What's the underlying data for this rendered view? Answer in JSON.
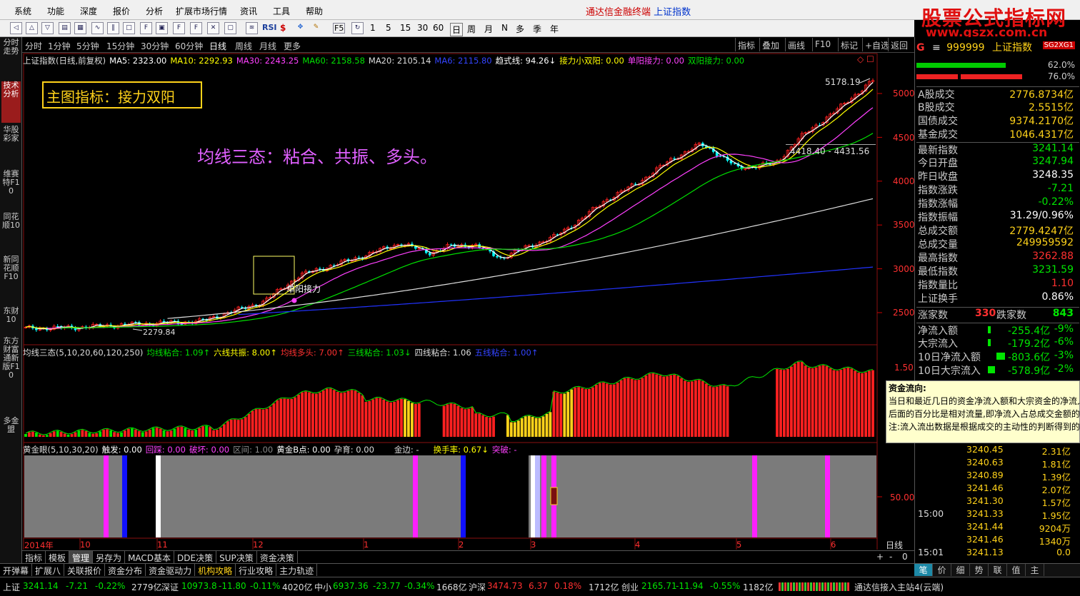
{
  "menu": {
    "items": [
      "系统",
      "功能",
      "深度",
      "报价",
      "分析",
      "扩展市场行情",
      "资讯",
      "工具",
      "帮助"
    ],
    "title_app": "通达信金融终端",
    "title_index": "上证指数"
  },
  "toolbar": {
    "buttons": [
      "RSI",
      "$",
      "F5",
      "1",
      "5",
      "15",
      "30",
      "60",
      "日",
      "周",
      "月",
      "N",
      "多",
      "季",
      "年"
    ]
  },
  "watermark": {
    "line1": "股票公式指标网",
    "line2": "www.gszx.com.cn"
  },
  "lefttabs": [
    "分时走势",
    "技术分析",
    "华股彩家",
    "维赛特F10",
    "同花顺10",
    "新同花顺F10",
    "东财10",
    "东方财富通新版F10",
    "多金盟"
  ],
  "periods": [
    "分时",
    "1分钟",
    "5分钟",
    "15分钟",
    "30分钟",
    "60分钟",
    "日线",
    "周线",
    "月线",
    "更多"
  ],
  "rightbtns": [
    "指标",
    "叠加",
    "画线",
    "F10",
    "标记",
    "+自选",
    "返回"
  ],
  "main_ind": {
    "name": "上证指数(日线,前复权)",
    "ma5": "MA5: 2323.00",
    "ma10": "MA10: 2292.93",
    "ma30": "MA30: 2243.25",
    "ma60": "MA60: 2158.58",
    "ma20": "MA20: 2105.14",
    "ma6": "MA6: 2115.80",
    "trend": "趋式线: 94.26↓",
    "relay": "接力小双阳: 0.00",
    "single": "单阳接力: 0.00",
    "double": "双阳接力: 0.00"
  },
  "annot": {
    "box": "主图指标：接力双阳",
    "text": "均线三态：粘合、共振、多头。",
    "hi": "5178.19",
    "range": "4418.40 - 4431.56",
    "lo": "2279.84",
    "relay_label": "单阳接力"
  },
  "price_axis": [
    "5000",
    "4500",
    "4000",
    "3500",
    "3000",
    "2500"
  ],
  "ind2": {
    "name": "均线三态(5,10,20,60,120,250)",
    "a": "均线粘合: 1.09↑",
    "b": "六线共振: 8.00↑",
    "c": "均线多头: 7.00↑",
    "d": "三线粘合: 1.03↓",
    "e": "四线粘合: 1.06",
    "f": "五线粘合: 1.00↑",
    "axis": "1.50"
  },
  "ind3": {
    "name": "黄金眼(5,10,30,20)",
    "a": "触发: 0.00",
    "b": "回踩: 0.00",
    "c": "破坏: 0.00",
    "d": "区间: 1.00",
    "e": "黄金B点: 0.00",
    "f": "孕育: 0.00",
    "g": "金边: -",
    "h": "换手率: 0.67↓",
    "i": "突破: -",
    "axis": "50.00"
  },
  "dates": [
    "2014年",
    "10",
    "11",
    "12",
    "1",
    "2",
    "3",
    "4",
    "5",
    "6"
  ],
  "day_label": "日线",
  "zoom": [
    "+",
    "-",
    "0"
  ],
  "bottabs": [
    "指标",
    "模板",
    "管理",
    "另存为",
    "MACD基本",
    "DDE决策",
    "SUP决策",
    "资金决策"
  ],
  "bottabs2": [
    "开弹幕",
    "扩展八",
    "关联报价",
    "资金分布",
    "资金驱动力",
    "机构攻略",
    "行业攻略",
    "主力轨迹"
  ],
  "status": {
    "sh": "上证",
    "sh_v": "3241.14",
    "sh_c": "-7.21",
    "sh_p": "-0.22%",
    "sh_a": "2779亿",
    "sz": "深证",
    "sz_v": "10973.8",
    "sz_c": "-11.80",
    "sz_p": "-0.11%",
    "sz_a": "4020亿",
    "zx": "中小",
    "zx_v": "6937.36",
    "zx_c": "-23.77",
    "zx_p": "-0.34%",
    "zx_a": "1668亿",
    "hs": "沪深",
    "hs_v": "3474.73",
    "hs_c": "6.37",
    "hs_p": "0.18%",
    "hs_a": "1712亿",
    "cy": "创业",
    "cy_v": "2165.71",
    "cy_c": "-11.94",
    "cy_p": "-0.55%",
    "cy_a": "1182亿",
    "conn": "通达信接入主站4(云端)"
  },
  "right": {
    "code": "999999",
    "name": "上证指数",
    "tag": "SG2XG1",
    "bar1": "62.0%",
    "bar2": "76.0%",
    "rows": [
      {
        "k": "A股成交",
        "v": "2776.8734亿",
        "c": "#ffd21a"
      },
      {
        "k": "B股成交",
        "v": "2.5515亿",
        "c": "#ffd21a"
      },
      {
        "k": "国债成交",
        "v": "9374.2170亿",
        "c": "#ffd21a"
      },
      {
        "k": "基金成交",
        "v": "1046.4317亿",
        "c": "#ffd21a"
      },
      {
        "k": "最新指数",
        "v": "3241.14",
        "c": "#00e600"
      },
      {
        "k": "今日开盘",
        "v": "3247.94",
        "c": "#00e600"
      },
      {
        "k": "昨日收盘",
        "v": "3248.35",
        "c": "#ffffff"
      },
      {
        "k": "指数涨跌",
        "v": "-7.21",
        "c": "#00e600"
      },
      {
        "k": "指数涨幅",
        "v": "-0.22%",
        "c": "#00e600"
      },
      {
        "k": "指数振幅",
        "v": "31.29/0.96%",
        "c": "#ffffff"
      },
      {
        "k": "总成交额",
        "v": "2779.4247亿",
        "c": "#ffd21a"
      },
      {
        "k": "总成交量",
        "v": "249959592",
        "c": "#ffd21a"
      },
      {
        "k": "最高指数",
        "v": "3262.88",
        "c": "#ff3030"
      },
      {
        "k": "最低指数",
        "v": "3231.59",
        "c": "#00e600"
      },
      {
        "k": "指数量比",
        "v": "1.10",
        "c": "#ff3030"
      },
      {
        "k": "上证换手",
        "v": "0.86%",
        "c": "#ffffff"
      }
    ],
    "adv_label": "涨家数",
    "adv": "330",
    "dec_label": "跌家数",
    "dec": "843",
    "flows": [
      {
        "k": "净流入额",
        "v": "-255.4亿",
        "p": "-9%"
      },
      {
        "k": "大宗流入",
        "v": "-179.2亿",
        "p": "-6%"
      },
      {
        "k": "10日净流入额",
        "v": "-803.6亿",
        "p": "-3%"
      },
      {
        "k": "10日大宗流入",
        "v": "-578.9亿",
        "p": "-2%"
      }
    ],
    "tooltip": [
      "资金流向:",
      "当日和最近几日的资金净流入额和大宗资金的净流入",
      "后面的百分比是相对流量,即净流入占总成交金额的",
      "注:流入流出数据是根据成交的主动性的判断得到的,"
    ],
    "ticks": [
      {
        "t": "",
        "p": "3240.45",
        "q": "2.31亿"
      },
      {
        "t": "",
        "p": "3240.63",
        "q": "1.81亿"
      },
      {
        "t": "",
        "p": "3240.89",
        "q": "1.39亿"
      },
      {
        "t": "",
        "p": "3241.46",
        "q": "2.07亿"
      },
      {
        "t": "",
        "p": "3241.30",
        "q": "1.57亿"
      },
      {
        "t": "15:00",
        "p": "3241.33",
        "q": "1.95亿"
      },
      {
        "t": "",
        "p": "3241.44",
        "q": "9204万"
      },
      {
        "t": "",
        "p": "3241.46",
        "q": "1340万"
      },
      {
        "t": "15:01",
        "p": "3241.13",
        "q": "0.0"
      }
    ],
    "tabs": [
      "笔",
      "价",
      "细",
      "势",
      "联",
      "值",
      "主"
    ]
  },
  "colors": {
    "up": "#ff2020",
    "down": "#00ffff",
    "ma5": "#ffffff",
    "ma10": "#ffff00",
    "ma30": "#ff40ff",
    "ma60": "#00e000",
    "ma120": "#e0e0e0",
    "ma250": "#2233ff",
    "green": "#00e600",
    "yellow": "#ffd21a",
    "magenta": "#ff40ff",
    "gray": "#7b7b7b"
  }
}
